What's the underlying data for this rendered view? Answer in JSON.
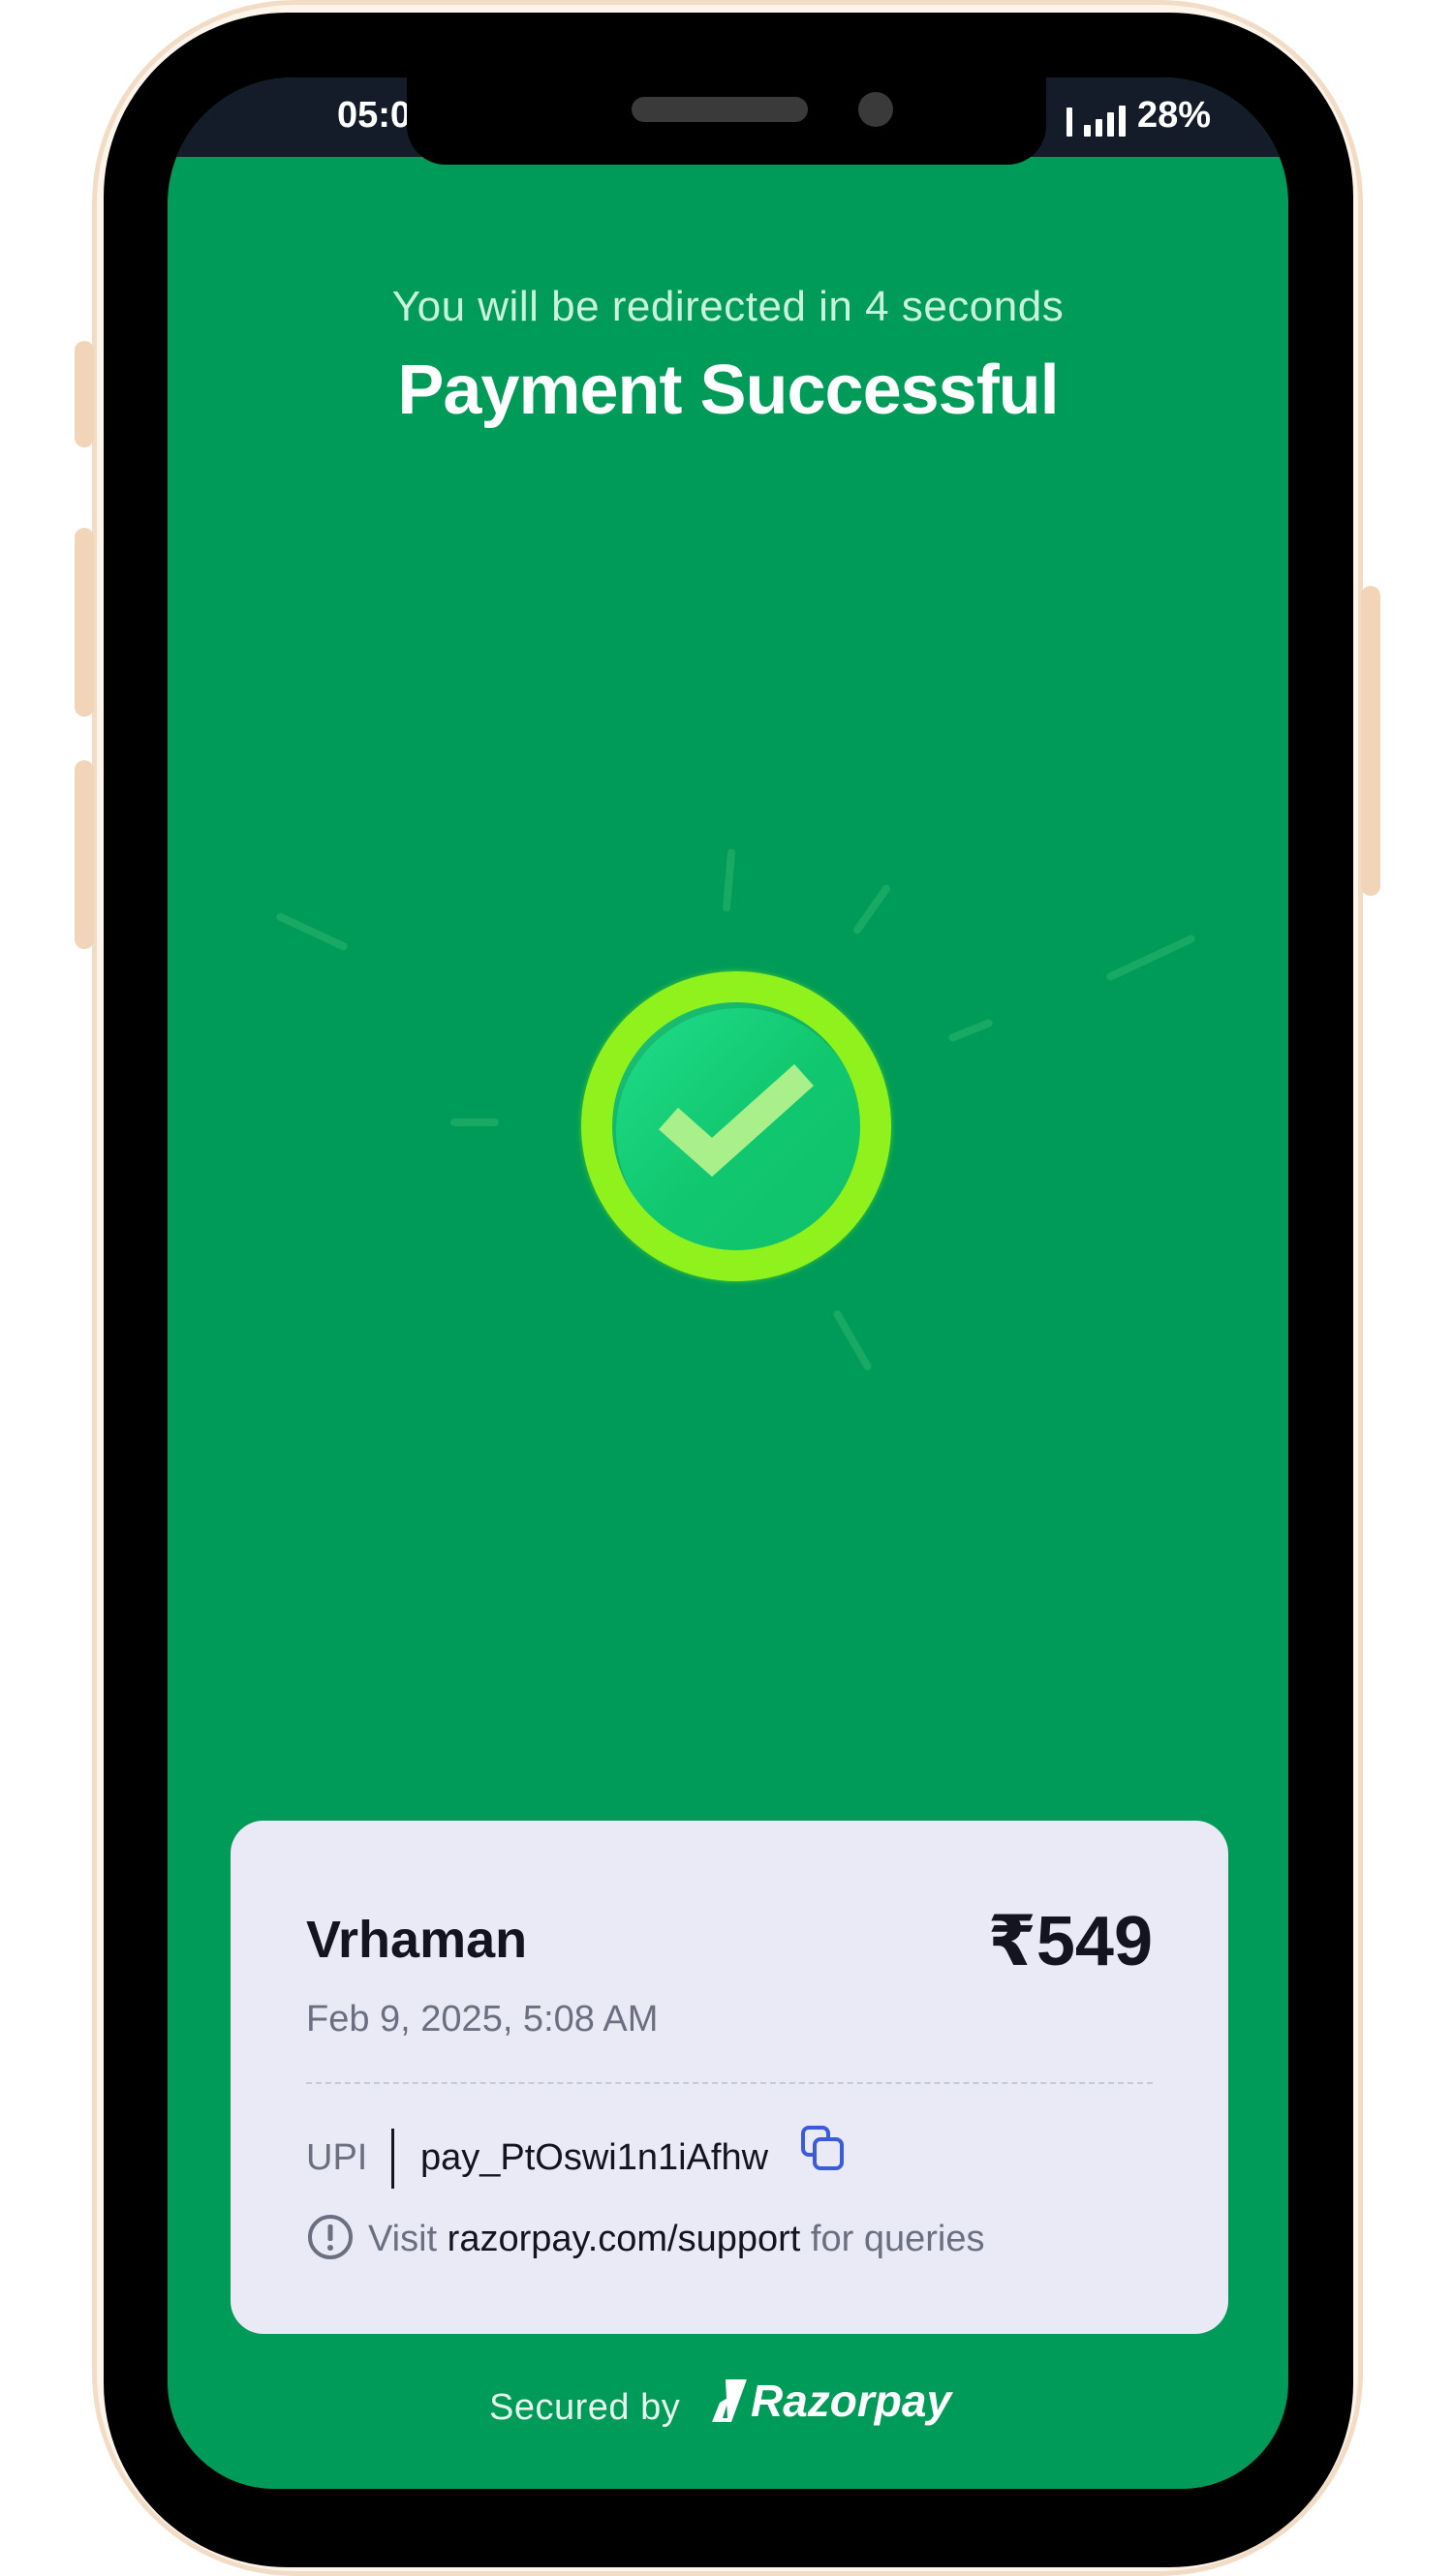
{
  "status_bar": {
    "time": "05:0",
    "battery": "28%"
  },
  "header": {
    "redirect_text": "You will be redirected in 4 seconds",
    "title": "Payment Successful"
  },
  "receipt": {
    "merchant": "Vrhaman",
    "amount": "₹549",
    "datetime": "Feb 9, 2025, 5:08 AM",
    "method": "UPI",
    "payment_id": "pay_PtOswi1n1iAfhw",
    "support_prefix": "Visit",
    "support_link": "razorpay.com/support",
    "support_suffix": "for queries"
  },
  "footer": {
    "secured_by": "Secured by",
    "brand": "Razorpay"
  },
  "colors": {
    "background": "#009b58",
    "check_ring": "#8ff21c",
    "check_fill": "#18d07a",
    "card": "#eaeaf7",
    "accent_icon": "#3b5bdb"
  },
  "icons": [
    "checkmark-icon",
    "copy-icon",
    "info-icon",
    "razorpay-logo"
  ]
}
